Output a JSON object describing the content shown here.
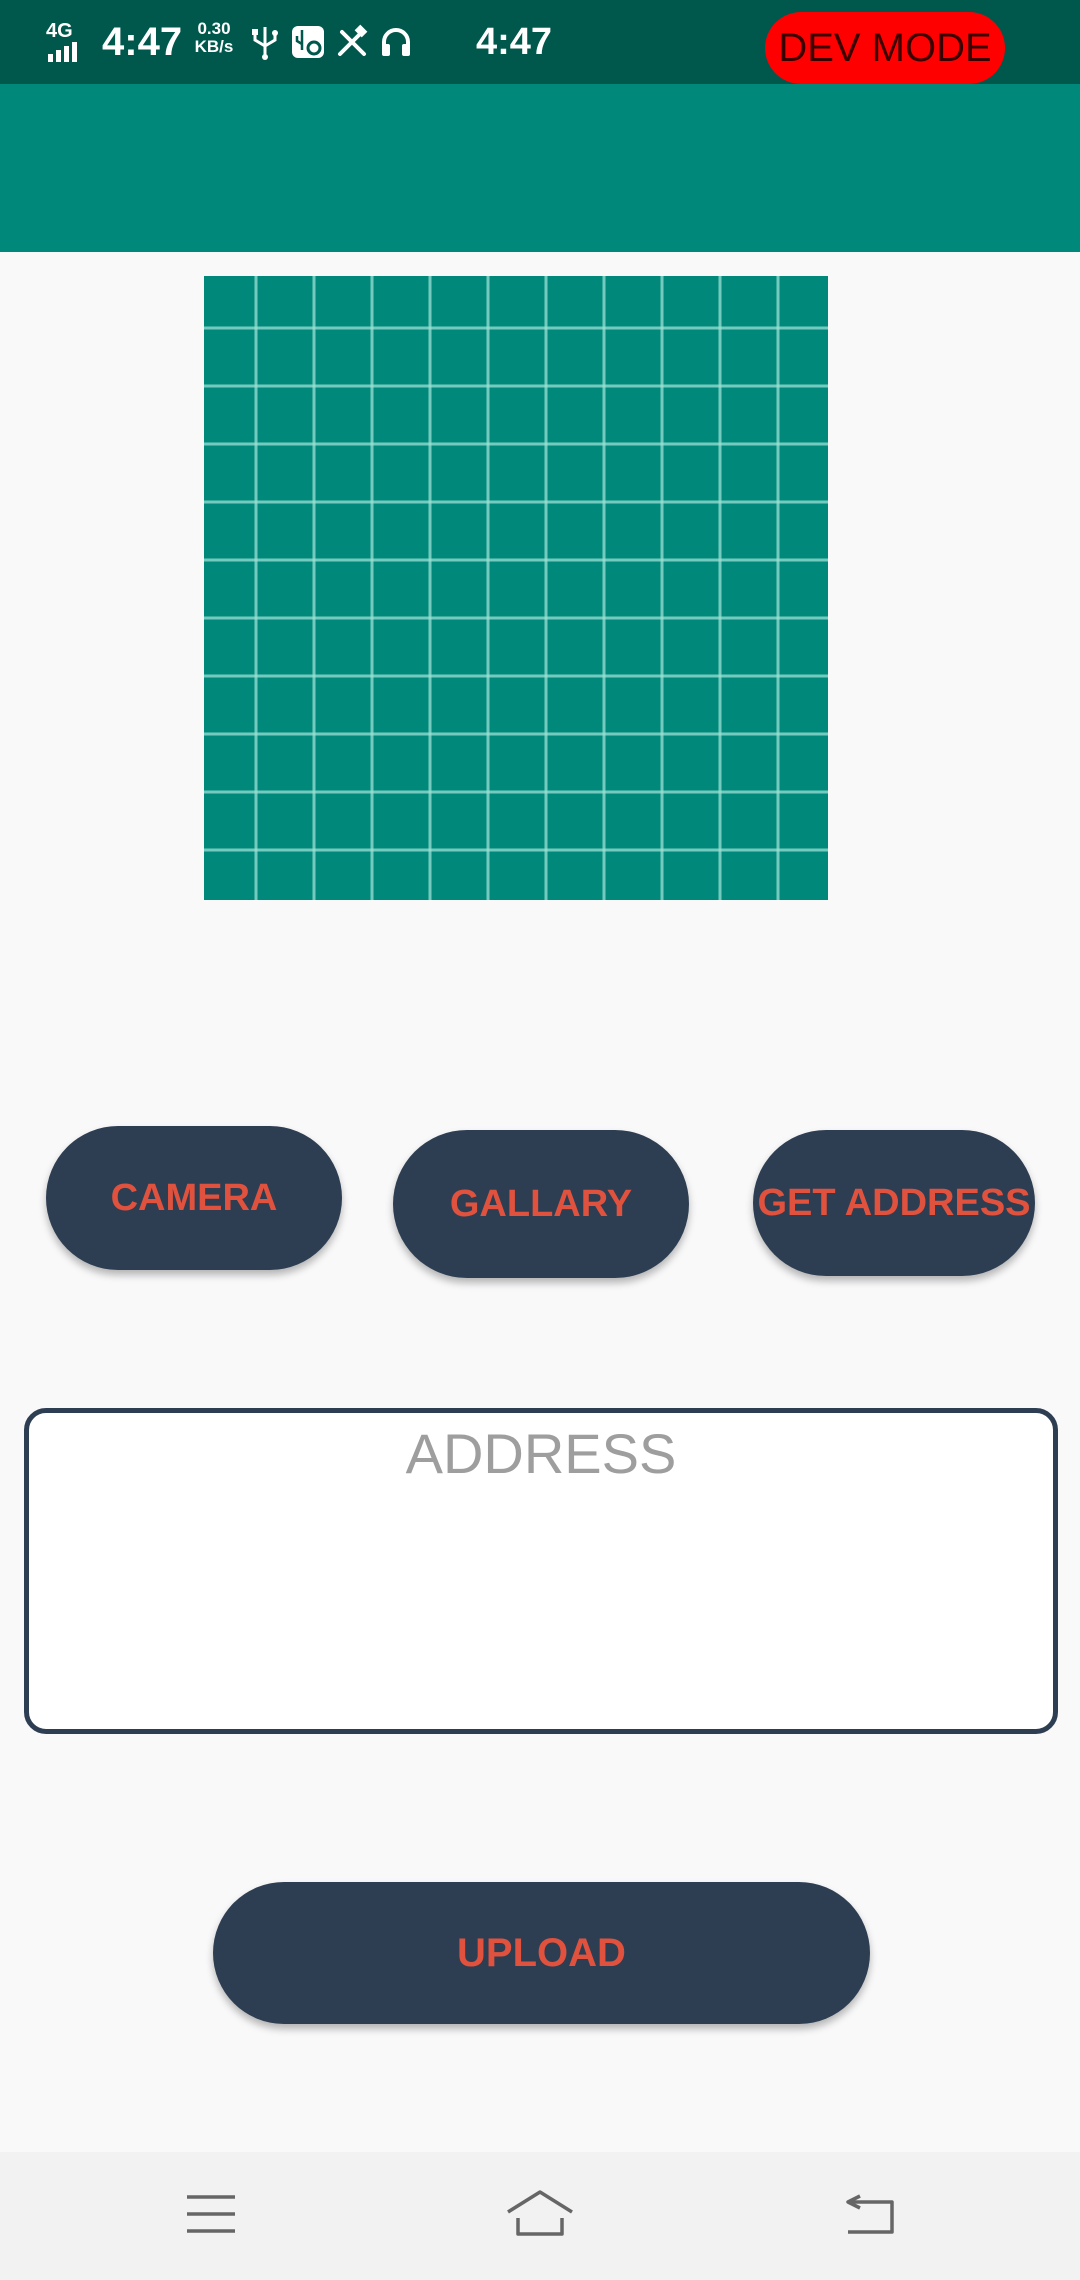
{
  "status_bar": {
    "network": "4G",
    "time_left": "4:47",
    "speed_value": "0.30",
    "speed_unit": "KB/s",
    "icons": [
      "signal-icon",
      "usb-icon",
      "usb-settings-icon",
      "tools-icon",
      "headphones-icon"
    ],
    "time_center": "4:47",
    "dev_mode_label": "DEV MODE"
  },
  "image_placeholder": {
    "icon": "grid-placeholder-image"
  },
  "buttons": {
    "camera": "CAMERA",
    "gallary": "GALLARY",
    "get_address": "GET ADDRESS",
    "upload": "UPLOAD"
  },
  "address": {
    "placeholder": "ADDRESS",
    "value": ""
  },
  "nav_bar": {
    "icons": [
      "menu-icon",
      "home-icon",
      "back-icon"
    ]
  },
  "colors": {
    "status_bar": "#00574b",
    "app_bar": "#00897b",
    "button_bg": "#2e3e52",
    "button_text": "#e0523e",
    "dev_mode_bg": "#ff0000"
  }
}
